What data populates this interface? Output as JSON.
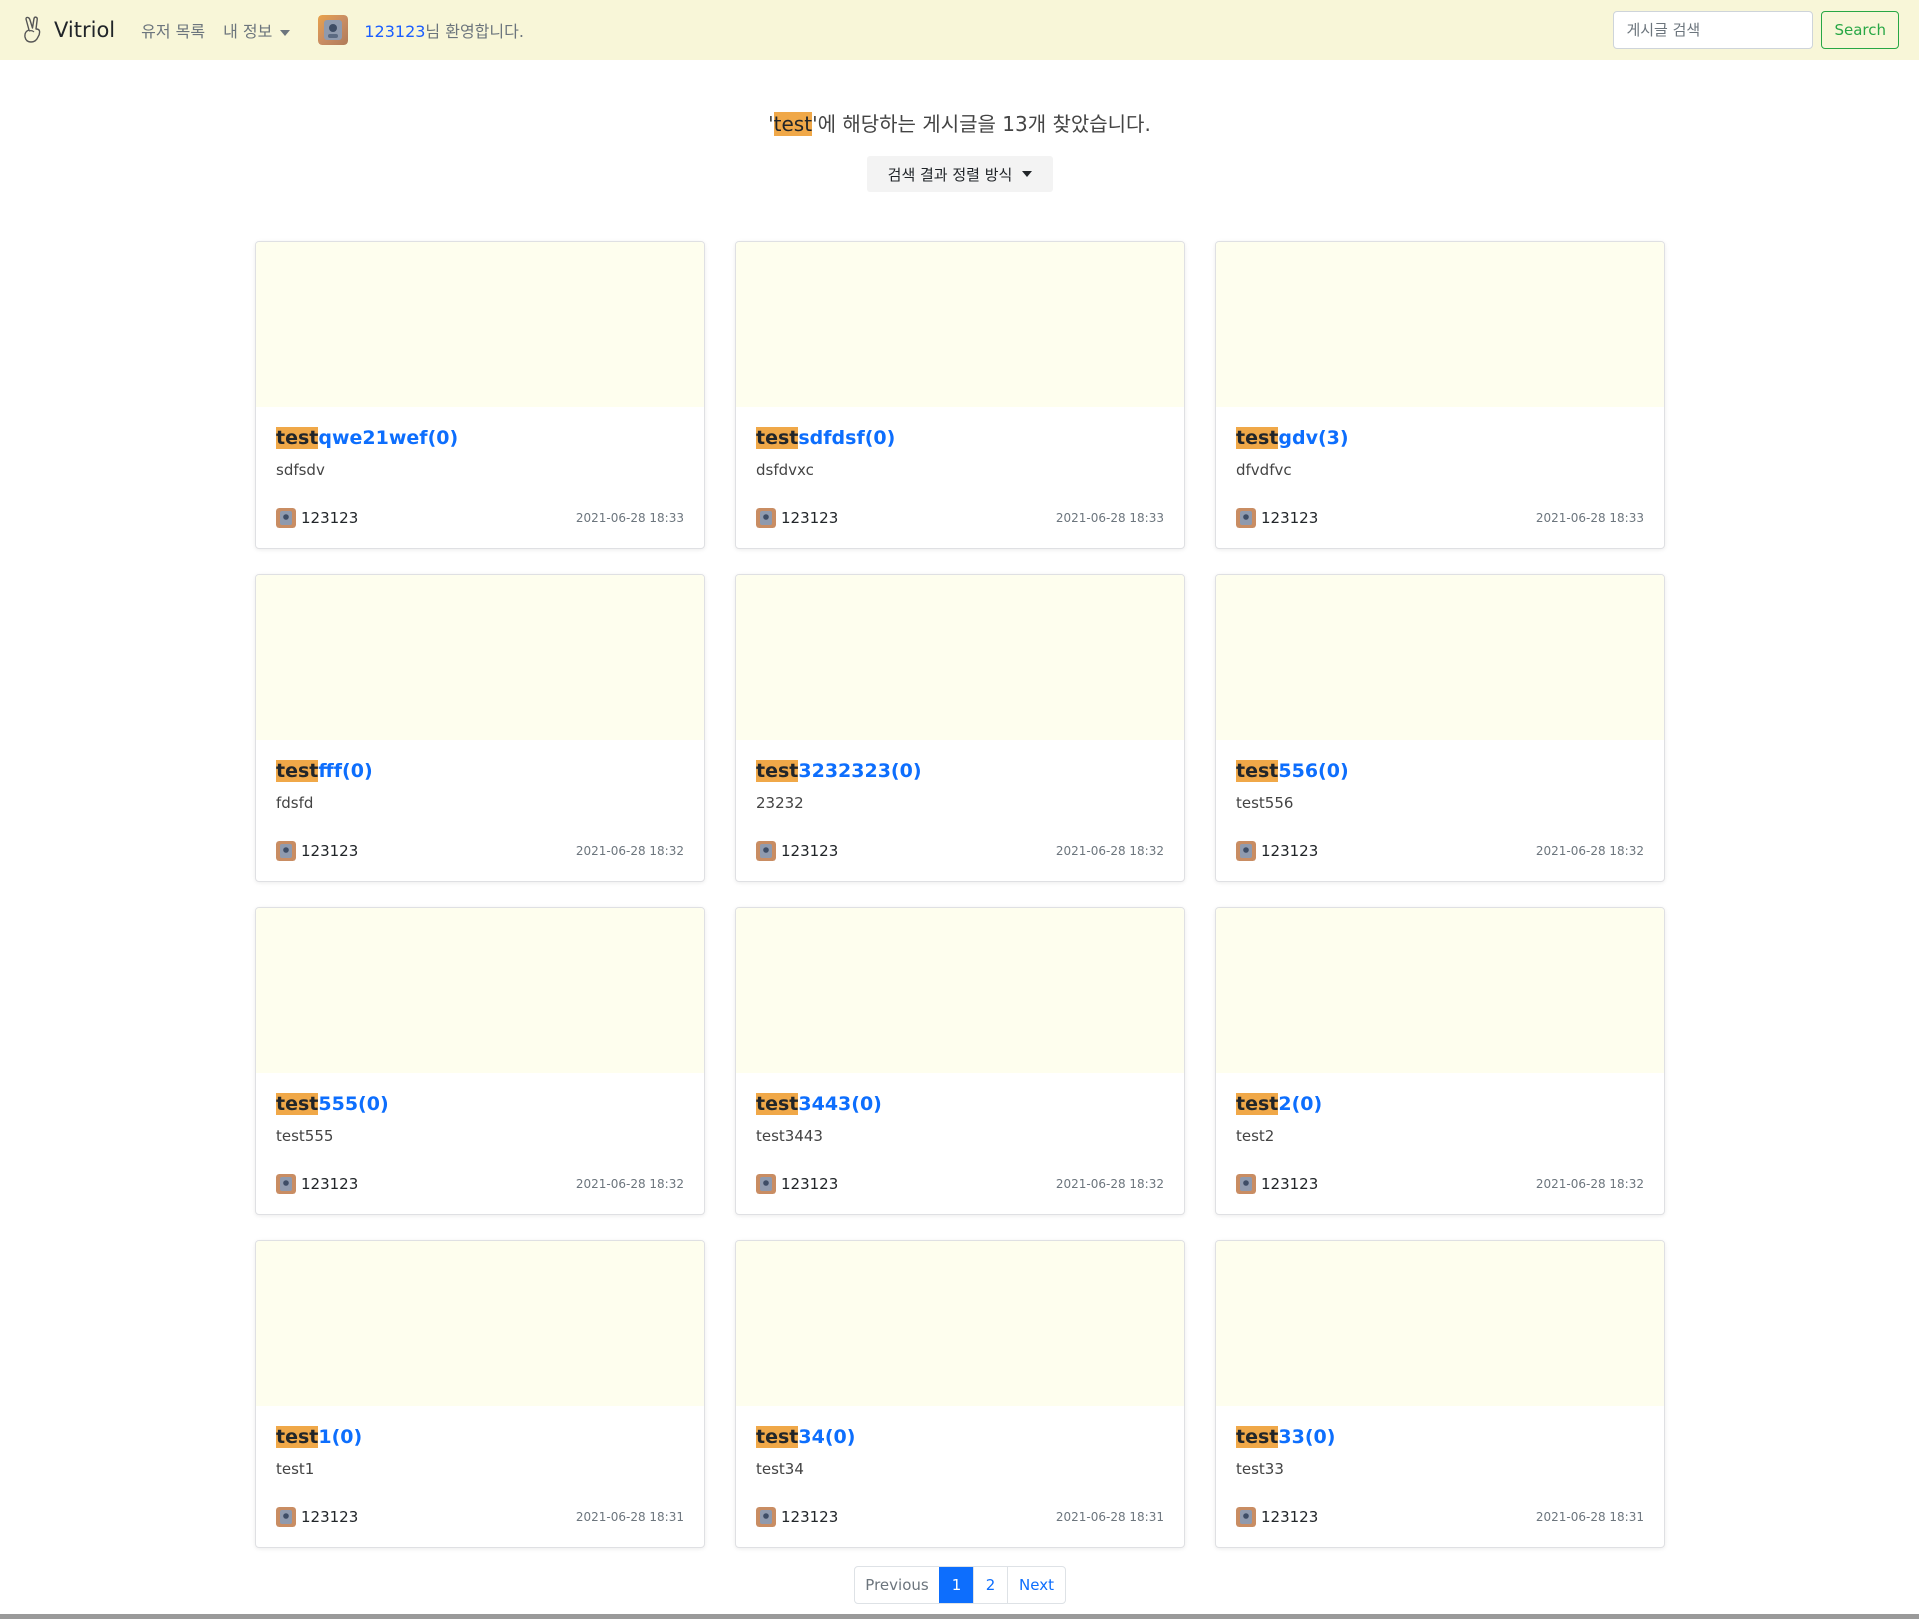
{
  "navbar": {
    "brand": "Vitriol",
    "brand_icon": "peace-hand-icon",
    "links": [
      "유저 목록",
      "내 정보"
    ],
    "welcome_user": "123123",
    "welcome_suffix": "님 환영합니다.",
    "search_placeholder": "게시글 검색",
    "search_button": "Search",
    "bg_color": "#f8f6d8"
  },
  "results": {
    "quote_open": "'",
    "keyword": "test",
    "mid": "'에 해당하는 게시글을 ",
    "count": "13",
    "suffix": "개 찾았습니다.",
    "sort_button": "검색 결과 정렬 방식"
  },
  "posts": [
    {
      "keyword": "test",
      "title_rest": "qwe21wef",
      "comments": "(0)",
      "body": "sdfsdv",
      "author": "123123",
      "date": "2021-06-28 18:33"
    },
    {
      "keyword": "test",
      "title_rest": "sdfdsf",
      "comments": "(0)",
      "body": "dsfdvxc",
      "author": "123123",
      "date": "2021-06-28 18:33"
    },
    {
      "keyword": "test",
      "title_rest": "gdv",
      "comments": "(3)",
      "body": "dfvdfvc",
      "author": "123123",
      "date": "2021-06-28 18:33"
    },
    {
      "keyword": "test",
      "title_rest": "fff",
      "comments": "(0)",
      "body": "fdsfd",
      "author": "123123",
      "date": "2021-06-28 18:32"
    },
    {
      "keyword": "test",
      "title_rest": "3232323",
      "comments": "(0)",
      "body": "23232",
      "author": "123123",
      "date": "2021-06-28 18:32"
    },
    {
      "keyword": "test",
      "title_rest": "556",
      "comments": "(0)",
      "body": "test556",
      "author": "123123",
      "date": "2021-06-28 18:32"
    },
    {
      "keyword": "test",
      "title_rest": "555",
      "comments": "(0)",
      "body": "test555",
      "author": "123123",
      "date": "2021-06-28 18:32"
    },
    {
      "keyword": "test",
      "title_rest": "3443",
      "comments": "(0)",
      "body": "test3443",
      "author": "123123",
      "date": "2021-06-28 18:32"
    },
    {
      "keyword": "test",
      "title_rest": "2",
      "comments": "(0)",
      "body": "test2",
      "author": "123123",
      "date": "2021-06-28 18:32"
    },
    {
      "keyword": "test",
      "title_rest": "1",
      "comments": "(0)",
      "body": "test1",
      "author": "123123",
      "date": "2021-06-28 18:31"
    },
    {
      "keyword": "test",
      "title_rest": "34",
      "comments": "(0)",
      "body": "test34",
      "author": "123123",
      "date": "2021-06-28 18:31"
    },
    {
      "keyword": "test",
      "title_rest": "33",
      "comments": "(0)",
      "body": "test33",
      "author": "123123",
      "date": "2021-06-28 18:31"
    }
  ],
  "pagination": {
    "previous": "Previous",
    "pages": [
      "1",
      "2"
    ],
    "current": "1",
    "next": "Next"
  },
  "colors": {
    "highlight": "#f0a848",
    "link": "#0d6efd",
    "card_image_bg": "#fefeee",
    "search_button": "#28a745"
  }
}
